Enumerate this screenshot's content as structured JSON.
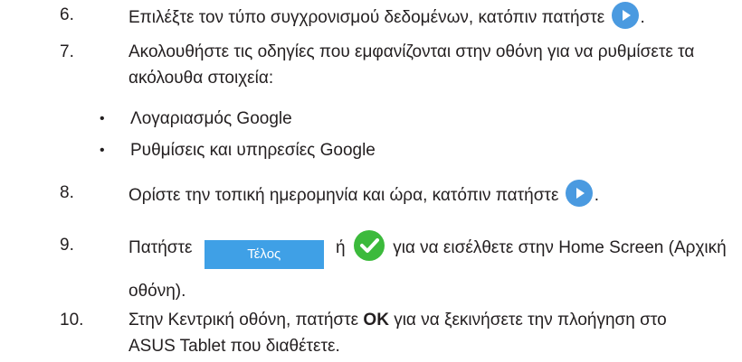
{
  "steps": [
    {
      "num": "6.",
      "text_before": "Επιλέξτε τον τύπο συγχρονισμού δεδομένων, κατόπιν πατήστε",
      "text_after": "."
    },
    {
      "num": "7.",
      "line1": "Ακολουθήστε τις οδηγίες που εμφανίζονται στην οθόνη για να ρυθμίσετε τα",
      "line2": "ακόλουθα στοιχεία:"
    },
    {
      "num": "8.",
      "text_before": "Ορίστε την τοπική ημερομηνία και ώρα, κατόπιν πατήστε",
      "text_after": "."
    },
    {
      "num": "9.",
      "text_before": "Πατήστε",
      "button_label": "Τέλος",
      "or_word": "ή",
      "text_after": "για να εισέλθετε στην Home Screen (Αρχική",
      "line2": "οθόνη)."
    },
    {
      "num": "10.",
      "text_before": "Στην Κεντρική οθόνη, πατήστε",
      "bold": "OK",
      "text_after": "για να ξεκινήσετε την πλοήγηση στο",
      "line2": "ASUS Tablet που διαθέτετε."
    }
  ],
  "bullets": [
    {
      "dot": "•",
      "text": "Λογαριασμός Google"
    },
    {
      "dot": "•",
      "text": "Ρυθμίσεις και υπηρεσίες Google"
    }
  ],
  "icons": {
    "next": "play-arrow-icon",
    "confirm": "checkmark-icon"
  },
  "colors": {
    "play_button": "#4a9ae0",
    "check_button": "#3cba3c",
    "done_button": "#3fa0e6",
    "text": "#231f20"
  }
}
